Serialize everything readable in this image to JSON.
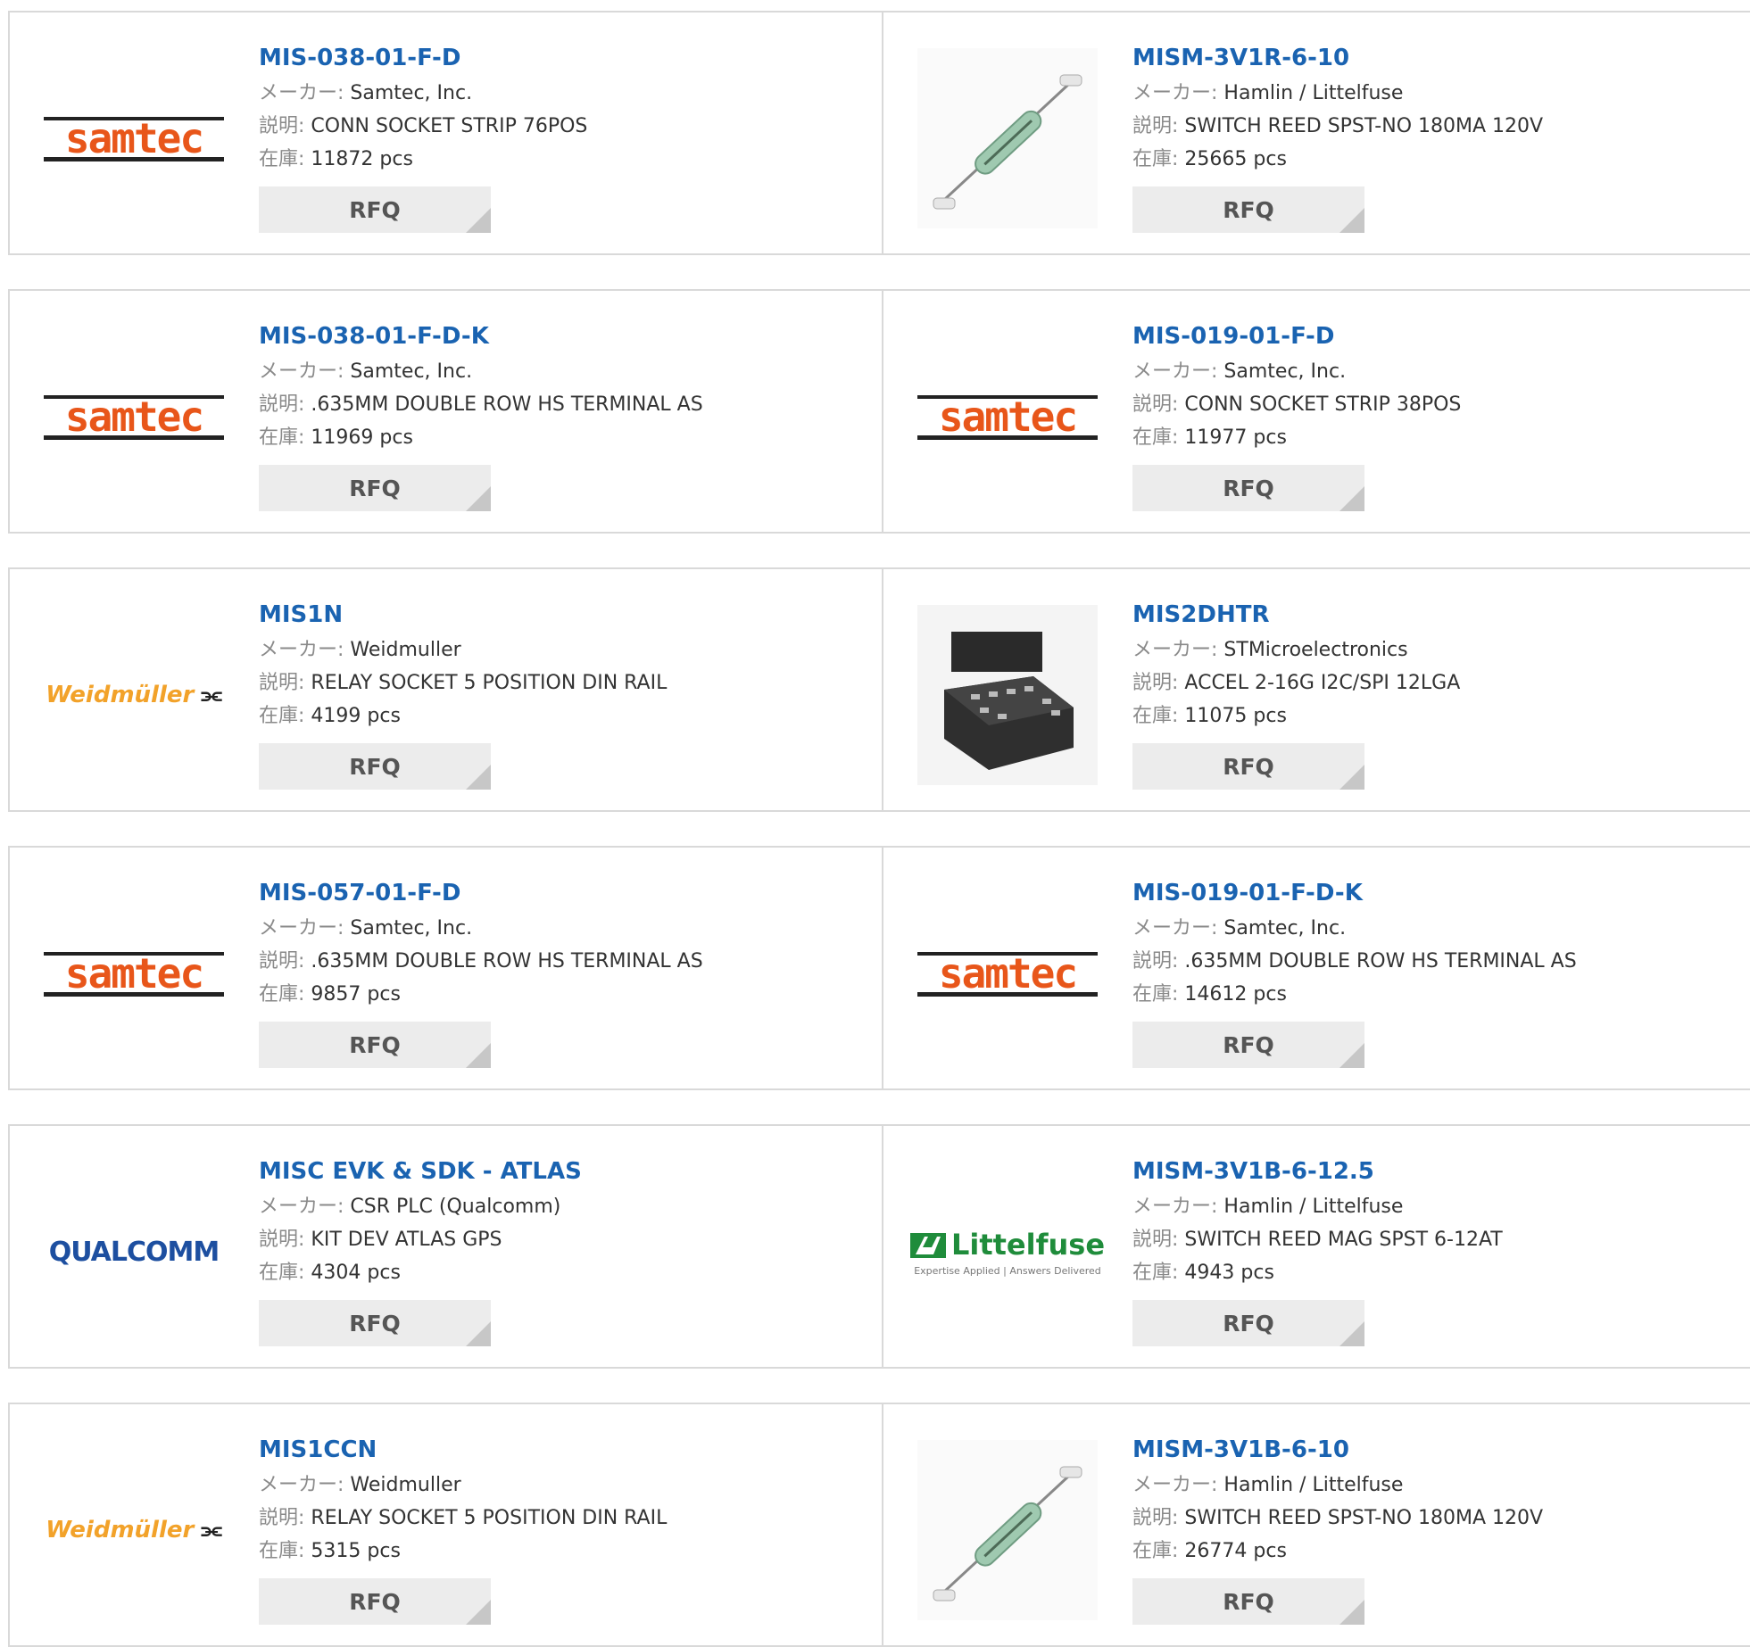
{
  "labels": {
    "maker": "メーカー:",
    "desc": "説明:",
    "stock": "在庫:",
    "rfq": "RFQ"
  },
  "rows": [
    {
      "left": {
        "part": "MIS-038-01-F-D",
        "maker": "Samtec, Inc.",
        "desc": "CONN SOCKET STRIP 76POS",
        "stock": "11872 pcs",
        "logo": "samtec"
      },
      "right": {
        "part": "MISM-3V1R-6-10",
        "maker": "Hamlin / Littelfuse",
        "desc": "SWITCH REED SPST-NO 180MA 120V",
        "stock": "25665 pcs",
        "logo": "reed-switch-photo"
      }
    },
    {
      "left": {
        "part": "MIS-038-01-F-D-K",
        "maker": "Samtec, Inc.",
        "desc": ".635MM DOUBLE ROW HS TERMINAL AS",
        "stock": "11969 pcs",
        "logo": "samtec"
      },
      "right": {
        "part": "MIS-019-01-F-D",
        "maker": "Samtec, Inc.",
        "desc": "CONN SOCKET STRIP 38POS",
        "stock": "11977 pcs",
        "logo": "samtec"
      }
    },
    {
      "left": {
        "part": "MIS1N",
        "maker": "Weidmuller",
        "desc": "RELAY SOCKET 5 POSITION DIN RAIL",
        "stock": "4199 pcs",
        "logo": "weidmuller",
        "logo_text": "Weidmüller"
      },
      "right": {
        "part": "MIS2DHTR",
        "maker": "STMicroelectronics",
        "desc": "ACCEL 2-16G I2C/SPI 12LGA",
        "stock": "11075 pcs",
        "logo": "lga-chip-photo"
      }
    },
    {
      "left": {
        "part": "MIS-057-01-F-D",
        "maker": "Samtec, Inc.",
        "desc": ".635MM DOUBLE ROW HS TERMINAL AS",
        "stock": "9857 pcs",
        "logo": "samtec"
      },
      "right": {
        "part": "MIS-019-01-F-D-K",
        "maker": "Samtec, Inc.",
        "desc": ".635MM DOUBLE ROW HS TERMINAL AS",
        "stock": "14612 pcs",
        "logo": "samtec"
      }
    },
    {
      "left": {
        "part": "MISC EVK & SDK - ATLAS",
        "maker": "CSR PLC (Qualcomm)",
        "desc": "KIT DEV ATLAS GPS",
        "stock": "4304 pcs",
        "logo": "qualcomm",
        "logo_text": "QUALCOMM"
      },
      "right": {
        "part": "MISM-3V1B-6-12.5",
        "maker": "Hamlin / Littelfuse",
        "desc": "SWITCH REED MAG SPST 6-12AT",
        "stock": "4943 pcs",
        "logo": "littelfuse",
        "logo_text": "Littelfuse",
        "logo_tagline": "Expertise Applied | Answers Delivered"
      }
    },
    {
      "left": {
        "part": "MIS1CCN",
        "maker": "Weidmuller",
        "desc": "RELAY SOCKET 5 POSITION DIN RAIL",
        "stock": "5315 pcs",
        "logo": "weidmuller",
        "logo_text": "Weidmüller"
      },
      "right": {
        "part": "MISM-3V1B-6-10",
        "maker": "Hamlin / Littelfuse",
        "desc": "SWITCH REED SPST-NO 180MA 120V",
        "stock": "26774 pcs",
        "logo": "reed-switch-photo"
      }
    }
  ],
  "colors": {
    "link": "#1a63b1",
    "samtec_orange": "#e8561a",
    "weidmuller_orange": "#f2a22a",
    "qualcomm_blue": "#1d4fa0",
    "littelfuse_green": "#1f8c3b",
    "border": "#d9d9d9",
    "rfq_bg": "#ececec"
  }
}
